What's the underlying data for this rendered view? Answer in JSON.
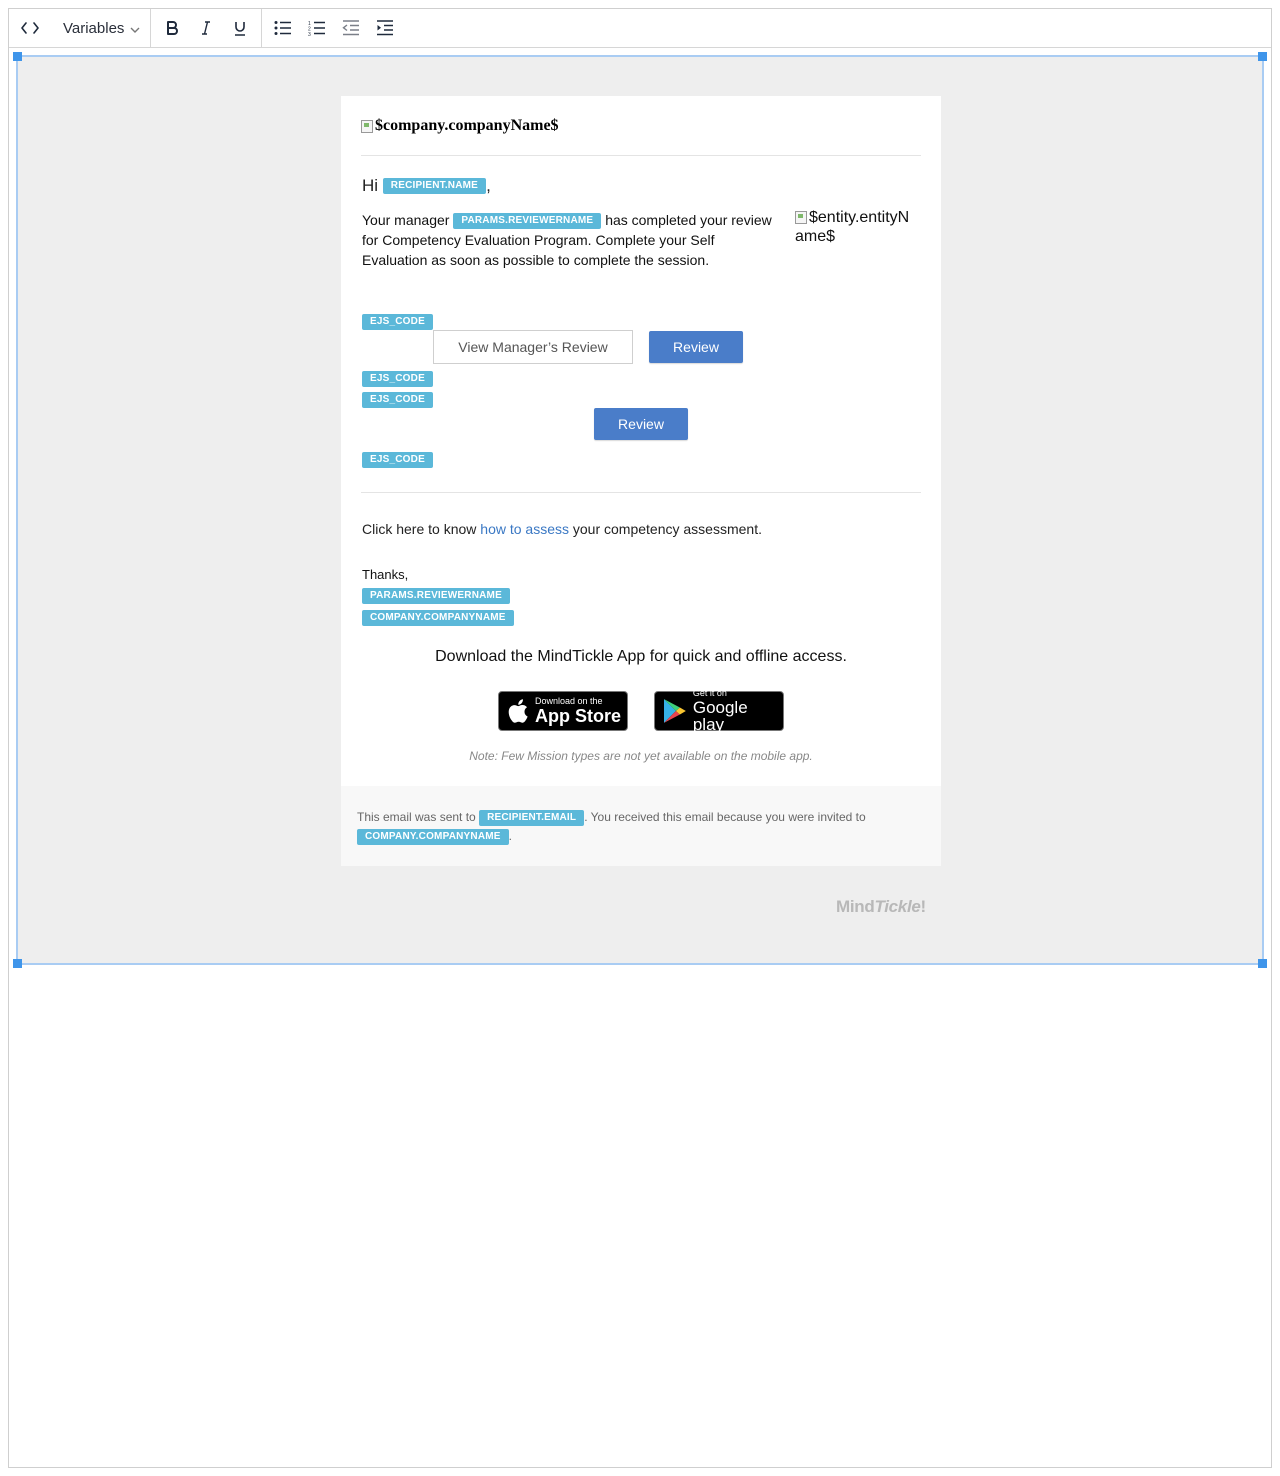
{
  "toolbar": {
    "source_icon": "code-icon",
    "variables_label": "Variables",
    "bold_icon": "bold-icon",
    "italic_icon": "italic-icon",
    "underline_icon": "underline-icon",
    "bullet_list_icon": "bullet-list-icon",
    "numbered_list_icon": "numbered-list-icon",
    "outdent_icon": "outdent-icon",
    "indent_icon": "indent-icon"
  },
  "email": {
    "logo_alt": "$company.companyName$",
    "greeting": "Hi",
    "greeting_suffix": ",",
    "tags": {
      "recipient_name": "RECIPIENT.NAME",
      "reviewer_name": "PARAMS.REVIEWERNAME",
      "ejs_code": "EJS_CODE",
      "company_name": "COMPANY.COMPANYNAME",
      "recipient_email": "RECIPIENT.EMAIL"
    },
    "body_prefix": "Your manager",
    "body_suffix": "has completed your review for Competency Evaluation Program. Complete your Self Evaluation as soon as possible to complete the session.",
    "entity_alt": "$entity.entityName$",
    "view_review_button": "View Manager’s Review",
    "review_button": "Review",
    "click_prefix": "Click here to know",
    "click_link": "how to assess",
    "click_suffix": "your competency assessment.",
    "thanks": "Thanks,",
    "download_text": "Download the MindTickle App for quick and offline access.",
    "appstore_small": "Download on the",
    "appstore_big": "App Store",
    "googleplay_small": "Get it on",
    "googleplay_big": "Google play",
    "note": "Note: Few Mission types are not yet available on the mobile app.",
    "footer_prefix": "This email was sent to",
    "footer_middle": ". You received this email because you were invited to",
    "footer_suffix": ".",
    "brand": "MindTickle",
    "brand_mark": "Mind",
    "brand_italic": "Tickle"
  },
  "colors": {
    "tag_bg": "#5bb8d9",
    "primary_button": "#4a7dc9",
    "link": "#3a78c4",
    "selection_border": "#a9ccf3",
    "selection_handle": "#3f95ea"
  }
}
